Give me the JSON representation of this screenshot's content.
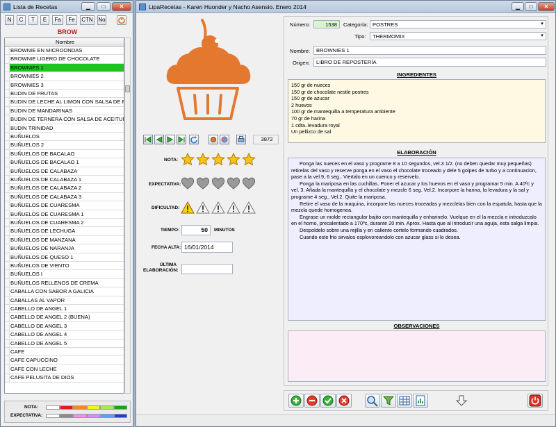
{
  "left_window": {
    "title": "Lista de Recetas",
    "letter_buttons": [
      "N",
      "C",
      "T",
      "E",
      "Fa",
      "Fe",
      "CTN",
      "No"
    ],
    "category": "BROW",
    "column_header": "Nombre",
    "rows": [
      "BROWNIE EN MICROONDAS",
      "BROWNIE LIGERO DE CHOCOLATE",
      "BROWNIES 1",
      "BROWNIES 2",
      "BROWNIES 3",
      "BUDIN DE FRUTAS",
      "BUDIN DE LECHE AL LIMON CON SALSA DE FRES",
      "BUDIN DE MANDARINAS",
      "BUDIN DE TERNERA CON SALSA DE ACEITUNAS",
      "BUDIN TRINIDAD",
      "BUÑUELOS",
      "BUÑUELOS 2",
      "BUÑUELOS DE BACALAO",
      "BUÑUELOS DE BACALAO 1",
      "BUÑUELOS DE CALABAZA",
      "BUÑUELOS DE CALABAZA 1",
      "BUÑUELOS DE CALABAZA 2",
      "BUÑUELOS DE CALABAZA 3",
      "BUÑUELOS DE CUARESMA",
      "BUÑUELOS DE CUARESMA 1",
      "BUÑUELOS DE CUARESMA 2",
      "BUÑUELOS DE LECHUGA",
      "BUÑUELOS DE MANZANA",
      "BUÑUELOS DE NARANJA",
      "BUÑUELOS DE QUESO 1",
      "BUÑUELOS DE VIENTO",
      "BUÑUELOS I",
      "BUÑUELOS RELLENOS DE CREMA",
      "CABALLA CON SABOR A GALICIA",
      "CABALLAS AL VAPOR",
      "CABELLO DE ANGEL 1",
      "CABELLO DE ANGEL 2 (BUENA)",
      "CABELLO DE ANGEL 3",
      "CABELLO DE ANGEL 4",
      "CABELLO DE ANGEL 5",
      "CAFE",
      "CAFE CAPUCCINO",
      "CAFE CON LECHE",
      "CAFE PELUSITA DE DIOS"
    ],
    "selected_row": "BROWNIES 1",
    "legend_nota_label": "NOTA:",
    "legend_expectativa_label": "EXPECTATIVA:",
    "nota_colors": [
      "#ffffff",
      "#e41a1a",
      "#f58a1e",
      "#f6f21a",
      "#a6e85a",
      "#1aa21a"
    ],
    "expectativa_colors": [
      "#ffffff",
      "#8a8a8a",
      "#ff8cf0",
      "#d98cff",
      "#5aa0ff",
      "#1a3cd9"
    ]
  },
  "main_window": {
    "title": "LipaRecetas - Karen Huonder y Nacho Asensio. Enero 2014",
    "record_count": "3872",
    "nota_label": "NOTA:",
    "nota_stars": 5,
    "expectativa_label": "EXPECTATIVA:",
    "expectativa_hearts": 0,
    "dificultad_label": "DIFICULTAD:",
    "dificultad_level": 1,
    "tiempo_label": "TIEMPO:",
    "tiempo_value": "50",
    "tiempo_unit": "MINUTOS",
    "fecha_label": "FECHA ALTA:",
    "fecha_value": "16/01/2014",
    "ultima_label": "ÚLTIMA ELABORACIÓN:",
    "ultima_value": "",
    "numero_label": "Número:",
    "numero_value": "1538",
    "categoria_label": "Categoría:",
    "categoria_value": "POSTRES",
    "tipo_label": "Tipo:",
    "tipo_value": "THERMOMIX",
    "nombre_label": "Nombre:",
    "nombre_value": "BROWNIES 1",
    "origen_label": "Origen:",
    "origen_value": "LIBRO DE REPOSTERÍA",
    "ingredientes_title": "INGREDIENTES",
    "ingredientes": [
      "150 gr de nueces",
      "150 gr de chocolate nestle postres",
      "150 gr de azucar",
      "2 huevos",
      "100 gr de mantequilla a temperatura ambiente",
      "70 gr de harina",
      "1 cdta..levadura royal",
      "Un pellizco de sal"
    ],
    "elaboracion_title": "ELABORACIÓN",
    "elaboracion": [
      "Ponga las nueces en el vaso y programe 8 a 10 segundos, vel.3 1/2. (no deben quedar muy pequeñas) retirelas del vaso y reserve ponga en el vaso el chocolate troceado y dele 5 golpes de turbo y a continuacion, pase a la vel.9, 6 seg.. Viertalo en un cuenco y reservelo.",
      "Ponga la mariposa en las cuchillas. Poner el azucar y los huevos en el vaso y programar 5 min. A 40ºc y vel. 3. Añada la mantequilla y el chocolate y mezcle 6 seg. Vel.2. Incorpore la harina, la levadura y la sal y programe 4 seg., Vel.2. Quite la mariposa.",
      "Retire el vaso de la maquina, incorpore las nueces troceadas y mezclelas bien con la espatula, hasta que la mezcla quede homogenea.",
      "Engrase un molde rectangular bajito con mantequilla y enharinelo. Vuelque en el la mezcla e introduzcalo en el horno, precalentado a 170ºc, durante 20 min. Aprox. Hasta que al introducir una aguja, esta salga limpia.",
      "Despoldelo sobre una rejilla y en caliente cortelo formando cuadrados.",
      "Cuando este frio sirvalos esplovoreandolo con azucar glass si lo desea."
    ],
    "observaciones_title": "OBSERVACIONES",
    "observaciones": ""
  },
  "colors": {
    "accent": "#e5782f",
    "selected": "#1ec51e",
    "ingredientes_bg": "#fff8e3",
    "elaboracion_bg": "#eeeeff",
    "observaciones_bg": "#fcecf6",
    "category_text": "#b02020",
    "numero_bg": "#d8f5d0"
  }
}
